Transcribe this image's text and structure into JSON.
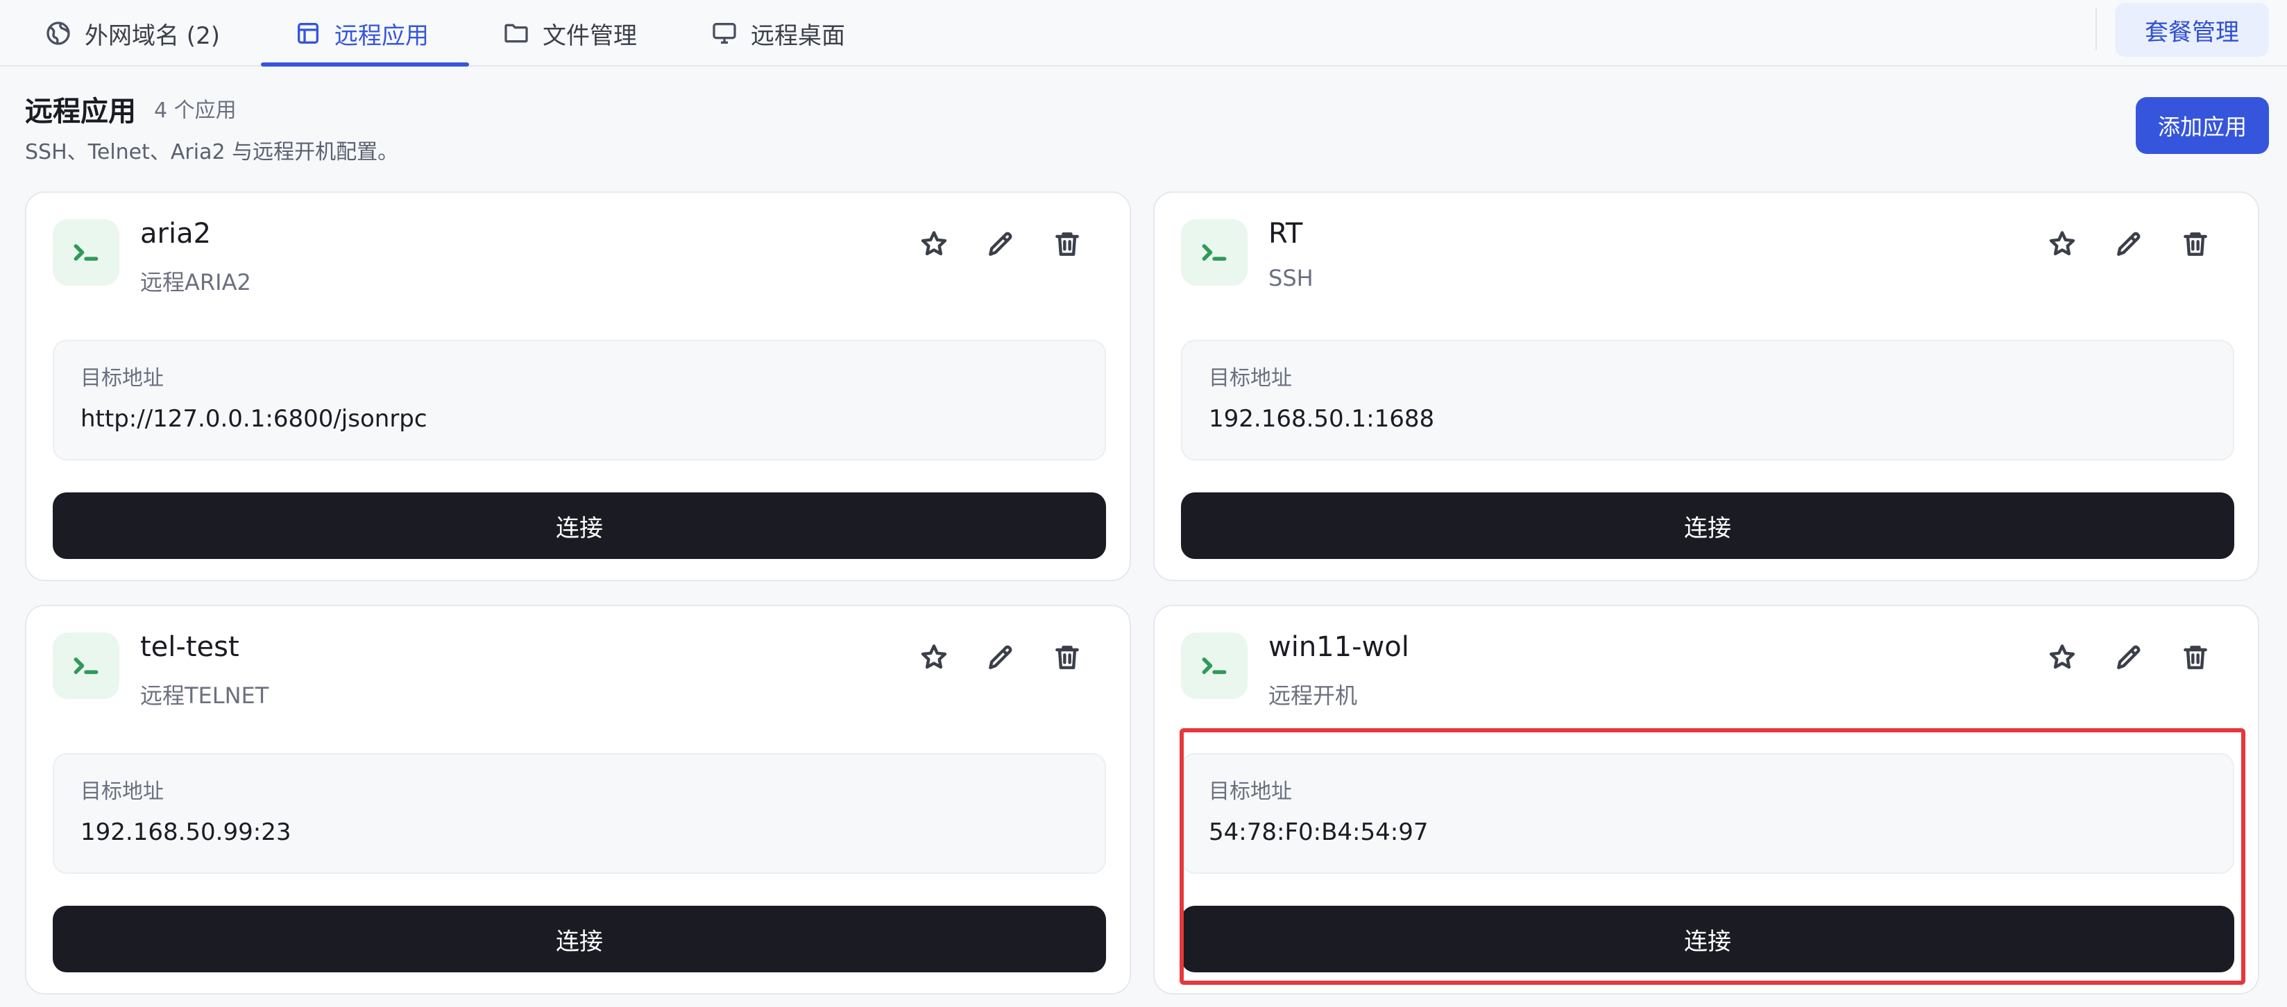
{
  "tabs": [
    {
      "label": "外网域名 (2)",
      "icon": "globe-icon",
      "active": false
    },
    {
      "label": "远程应用",
      "icon": "layout-icon",
      "active": true
    },
    {
      "label": "文件管理",
      "icon": "folder-icon",
      "active": false
    },
    {
      "label": "远程桌面",
      "icon": "monitor-icon",
      "active": false
    }
  ],
  "plan_button": "套餐管理",
  "section": {
    "title": "远程应用",
    "count": "4 个应用",
    "description": "SSH、Telnet、Aria2 与远程开机配置。",
    "add_button": "添加应用"
  },
  "address_label": "目标地址",
  "connect_label": "连接",
  "cards": [
    {
      "name": "aria2",
      "type": "远程ARIA2",
      "address": "http://127.0.0.1:6800/jsonrpc"
    },
    {
      "name": "RT",
      "type": "SSH",
      "address": "192.168.50.1:1688"
    },
    {
      "name": "tel-test",
      "type": "远程TELNET",
      "address": "192.168.50.99:23"
    },
    {
      "name": "win11-wol",
      "type": "远程开机",
      "address": "54:78:F0:B4:54:97"
    }
  ],
  "colors": {
    "accent": "#3556dc",
    "dark_button": "#1a1b23",
    "highlight": "#e5383b",
    "icon_bg": "#eaf7ee",
    "icon_fg": "#2f9a58"
  }
}
